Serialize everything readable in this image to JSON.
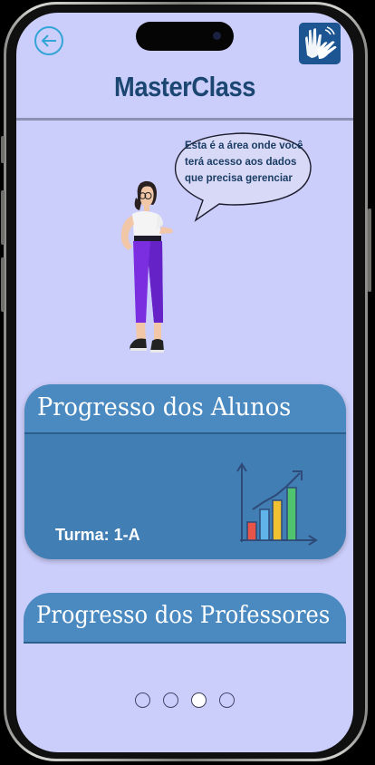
{
  "header": {
    "title": "MasterClass",
    "back_icon": "arrow-left-circle-icon",
    "accessibility_icon": "sign-language-hands-icon"
  },
  "assistant": {
    "speech": "Esta é a área onde você terá acesso aos dados que precisa gerenciar"
  },
  "cards": [
    {
      "title": "Progresso dos Alunos",
      "subtitle": "Turma: 1-A",
      "icon": "bar-chart-growth-icon"
    },
    {
      "title": "Progresso dos Professores"
    }
  ],
  "pagination": {
    "total": 4,
    "active": 3
  },
  "colors": {
    "background": "#cbcdfa",
    "title": "#1b4672",
    "card": "#417eb3",
    "card_header": "#4a8ac0",
    "accent": "#33a5d6",
    "libras_button": "#1c5592"
  }
}
